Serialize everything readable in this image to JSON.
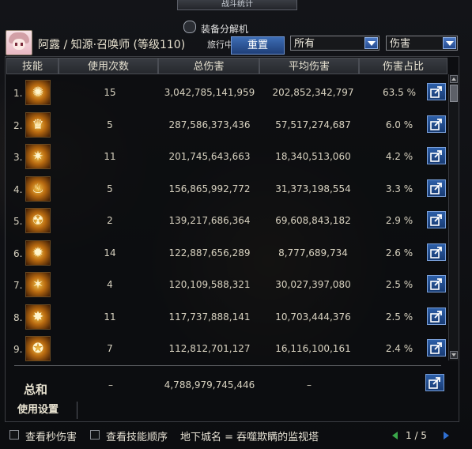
{
  "window": {
    "title": "战斗统计"
  },
  "header": {
    "player_name": "阿露 / 知源·召唤师 (等级110)",
    "machine_label": "装备分解机",
    "traveling_label": "旅行中的",
    "reset_label": "重置",
    "filter_select": "所有",
    "metric_select": "伤害"
  },
  "columns": [
    "技能",
    "使用次数",
    "总伤害",
    "平均伤害",
    "伤害占比"
  ],
  "rows": [
    {
      "rank": "1.",
      "uses": "15",
      "total": "3,042,785,141,959",
      "avg": "202,852,342,797",
      "share": "63.5 %",
      "icon": "skill-icon-1"
    },
    {
      "rank": "2.",
      "uses": "5",
      "total": "287,586,373,436",
      "avg": "57,517,274,687",
      "share": "6.0 %",
      "icon": "skill-icon-2"
    },
    {
      "rank": "3.",
      "uses": "11",
      "total": "201,745,643,663",
      "avg": "18,340,513,060",
      "share": "4.2 %",
      "icon": "skill-icon-3"
    },
    {
      "rank": "4.",
      "uses": "5",
      "total": "156,865,992,772",
      "avg": "31,373,198,554",
      "share": "3.3 %",
      "icon": "skill-icon-4"
    },
    {
      "rank": "5.",
      "uses": "2",
      "total": "139,217,686,364",
      "avg": "69,608,843,182",
      "share": "2.9 %",
      "icon": "skill-icon-5"
    },
    {
      "rank": "6.",
      "uses": "14",
      "total": "122,887,656,289",
      "avg": "8,777,689,734",
      "share": "2.6 %",
      "icon": "skill-icon-6"
    },
    {
      "rank": "7.",
      "uses": "4",
      "total": "120,109,588,321",
      "avg": "30,027,397,080",
      "share": "2.5 %",
      "icon": "skill-icon-7"
    },
    {
      "rank": "8.",
      "uses": "11",
      "total": "117,737,888,141",
      "avg": "10,703,444,376",
      "share": "2.5 %",
      "icon": "skill-icon-8"
    },
    {
      "rank": "9.",
      "uses": "7",
      "total": "112,812,701,127",
      "avg": "16,116,100,161",
      "share": "2.4 %",
      "icon": "skill-icon-9"
    }
  ],
  "total": {
    "label": "总和",
    "uses": "–",
    "total": "4,788,979,745,446",
    "avg": "–"
  },
  "settings_label": "使用设置",
  "footer": {
    "check_dps_label": "查看秒伤害",
    "check_order_label": "查看技能顺序",
    "dungeon_text": "地下城名 = 吞噬欺瞒的监视塔",
    "page_text": "1 / 5"
  },
  "colors": {
    "accent": "#2d5fa8",
    "gold": "#e0b04a"
  }
}
